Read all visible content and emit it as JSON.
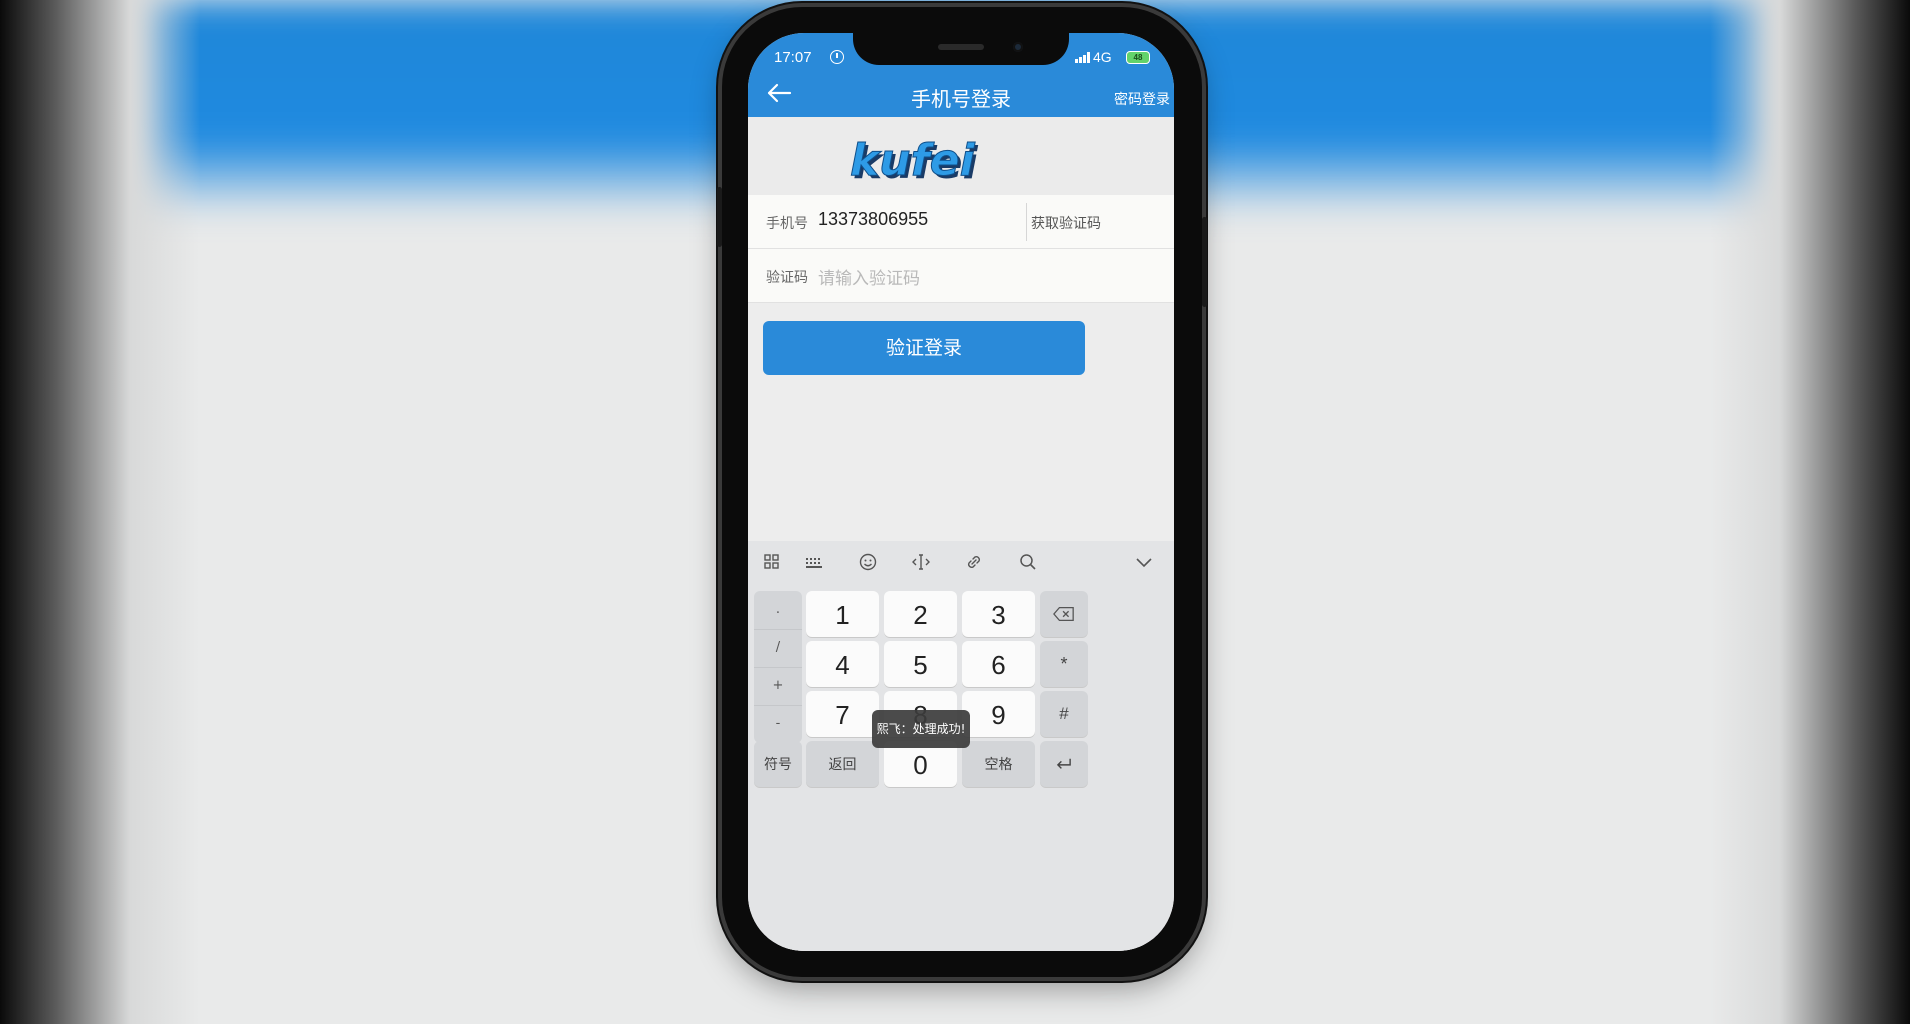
{
  "status_bar": {
    "time": "17:07",
    "network": "4G",
    "battery": "48"
  },
  "header": {
    "title": "手机号登录",
    "password_login": "密码登录"
  },
  "logo": {
    "text": "kufei",
    "color": "#2e9be6"
  },
  "form": {
    "phone_label": "手机号",
    "phone_value": "13373806955",
    "get_code_label": "获取验证码",
    "code_label": "验证码",
    "code_placeholder": "请输入验证码"
  },
  "login_button": {
    "label": "验证登录",
    "color": "#2a8ad9"
  },
  "keyboard": {
    "toolbar_icons": [
      "apps-grid-icon",
      "keyboard-icon",
      "emoji-icon",
      "cursor-move-icon",
      "link-icon",
      "search-icon",
      "chevron-down-icon"
    ],
    "symbol_keys": [
      ".",
      "/",
      "+",
      "-"
    ],
    "digits": [
      "1",
      "2",
      "3",
      "4",
      "5",
      "6",
      "7",
      "8",
      "9",
      "0"
    ],
    "star": "*",
    "hash": "#",
    "symbols_label": "符号",
    "back_label": "返回",
    "space_label": "空格"
  },
  "toast": {
    "message": "熙飞：处理成功!"
  },
  "theme": {
    "primary": "#2a8ad9",
    "background": "#ededed"
  }
}
